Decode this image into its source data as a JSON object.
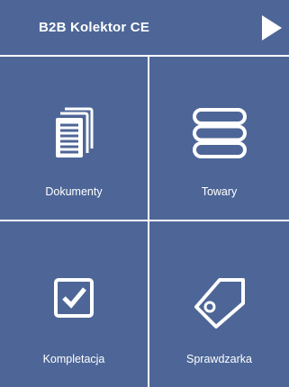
{
  "header": {
    "title": "B2B Kolektor CE",
    "play_icon": "play-icon"
  },
  "tiles": [
    {
      "label": "Dokumenty",
      "icon": "documents-icon"
    },
    {
      "label": "Towary",
      "icon": "database-icon"
    },
    {
      "label": "Kompletacja",
      "icon": "checkbox-icon"
    },
    {
      "label": "Sprawdzarka",
      "icon": "price-tag-icon"
    }
  ],
  "colors": {
    "tile_background": "#4d6697",
    "foreground": "#ffffff",
    "gap": "#ffffff"
  }
}
